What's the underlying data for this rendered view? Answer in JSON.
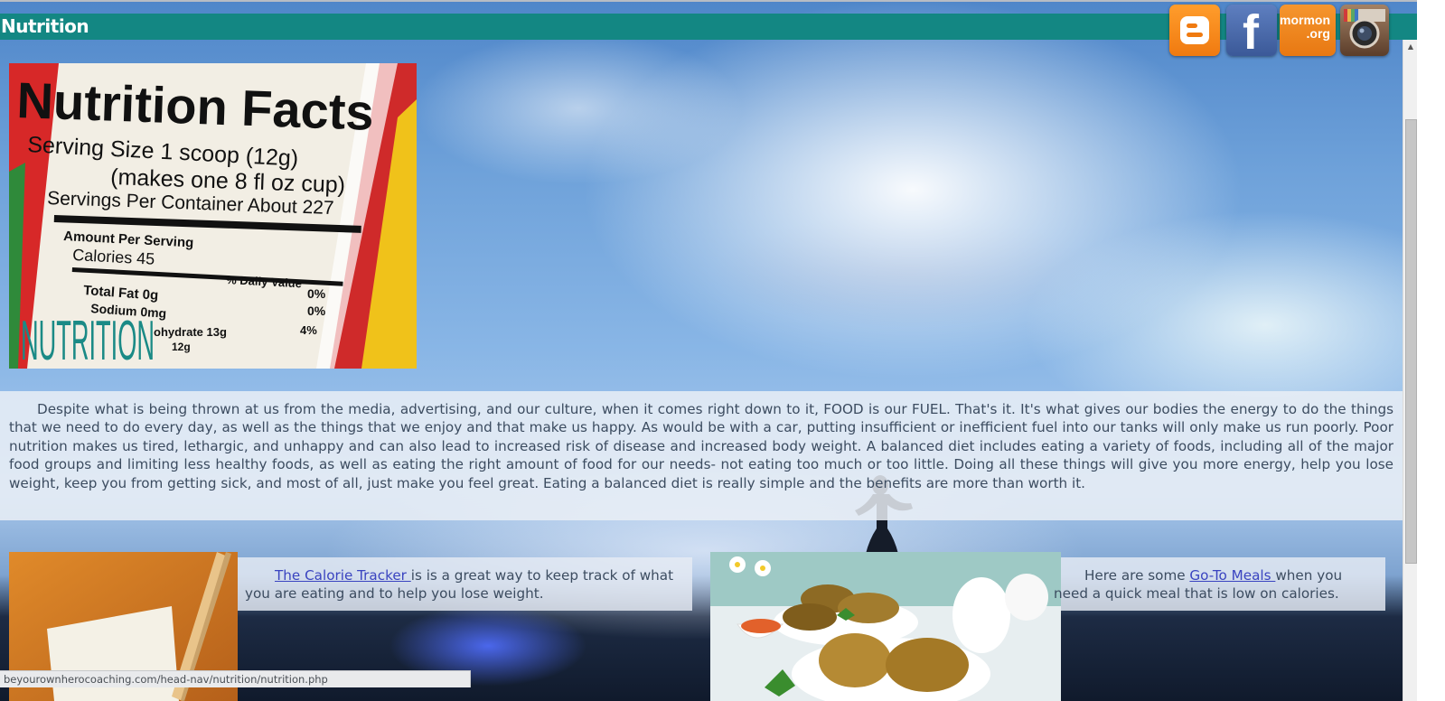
{
  "header": {
    "title": "Nutrition"
  },
  "social": {
    "blogger": {
      "icon": "blogger-icon",
      "color": "#f57d00"
    },
    "facebook": {
      "icon": "facebook-icon",
      "glyph": "f",
      "color": "#3b5998"
    },
    "mormon": {
      "icon": "mormon-org-icon",
      "line1": "mormon",
      "line2": ".org",
      "color": "#f08a1e"
    },
    "instagram": {
      "icon": "instagram-icon",
      "color": "#7a5a40"
    }
  },
  "hero_image": {
    "title": "Nutrition Facts",
    "serving_size": "Serving Size 1 scoop (12g)",
    "makes": "(makes one 8 fl oz cup)",
    "servings": "Servings Per Container About 227",
    "amount_per_serving": "Amount Per Serving",
    "calories": "Calories 45",
    "daily_value": "% Daily Value*",
    "total_fat": "Total Fat 0g",
    "total_fat_pct": "0%",
    "sodium": "Sodium 0mg",
    "sodium_pct": "0%",
    "carb": "ohydrate 13g",
    "carb_pct": "4%",
    "sugar": "12g",
    "overlay": "NUTRITION"
  },
  "intro": {
    "text": "Despite what is being thrown at us from the media, advertising, and our culture, when it comes right down to it, FOOD is our FUEL. That's it. It's what gives our bodies the energy to do the things that we need to do every day, as well as the things that we enjoy and that make us happy. As would be with a car, putting insufficient or inefficient fuel into our tanks will only make us run poorly. Poor nutrition makes us tired, lethargic, and unhappy and can also lead to increased risk of disease and increased body weight. A balanced diet includes eating a variety of foods, including all of the major food groups and limiting less healthy foods, as well as eating the right amount of food for our needs- not eating too much or too little. Doing all these things will give you more energy, help you lose weight, keep you from getting sick, and most of all, just make you feel great. Eating a balanced diet is really simple and the benefits are more than worth it."
  },
  "tracker": {
    "link": "The Calorie Tracker ",
    "text": "is is a great way to keep track of what you are eating and to help you lose weight."
  },
  "meals": {
    "prefix": "Here are some ",
    "link": "Go-To Meals ",
    "text": "when you need a quick meal that is low on calories."
  },
  "status_bar": {
    "url": "beyourownherocoaching.com/head-nav/nutrition/nutrition.php"
  },
  "colors": {
    "header": "#138783",
    "text": "#3c4c60",
    "link": "#3a44c0"
  }
}
